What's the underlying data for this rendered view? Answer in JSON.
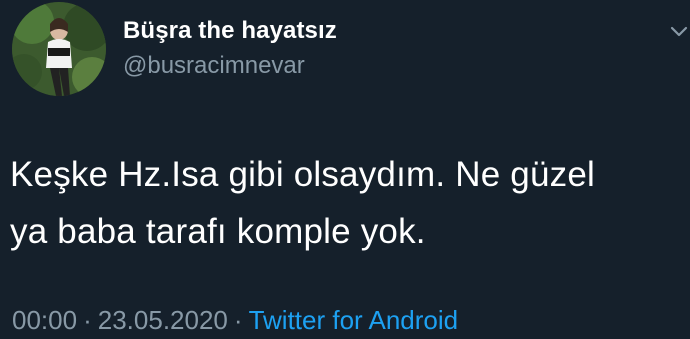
{
  "author": {
    "display_name": "Büşra the hayatsız",
    "handle": "@busracimnevar"
  },
  "tweet": {
    "lines": [
      "Keşke Hz.Isa gibi olsaydım. Ne güzel",
      "ya baba tarafı komple yok."
    ]
  },
  "meta": {
    "time": "00:00",
    "separator": "·",
    "date": "23.05.2020",
    "source": "Twitter for Android"
  },
  "icons": {
    "avatar": "profile-photo",
    "more": "chevron-down-icon"
  },
  "colors": {
    "background": "#15202b",
    "primary_text": "#ffffff",
    "secondary_text": "#8899a6",
    "link": "#1da1f2"
  }
}
